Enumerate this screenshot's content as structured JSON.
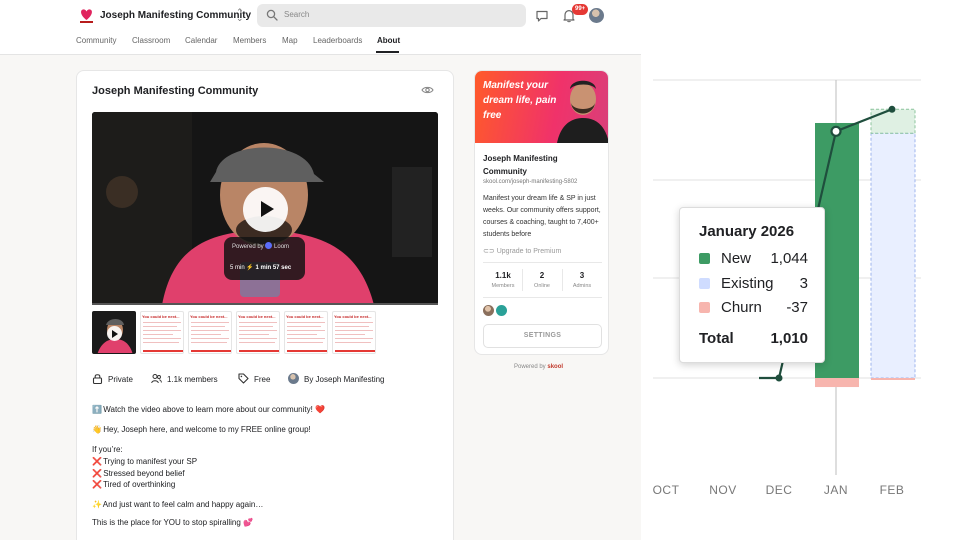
{
  "app": {
    "community_name": "Joseph Manifesting Community",
    "search_placeholder": "Search",
    "notifications_badge": "99+",
    "tabs": [
      {
        "label": "Community"
      },
      {
        "label": "Classroom"
      },
      {
        "label": "Calendar"
      },
      {
        "label": "Members"
      },
      {
        "label": "Map"
      },
      {
        "label": "Leaderboards"
      },
      {
        "label": "About"
      }
    ],
    "active_tab": "About"
  },
  "about": {
    "title": "Joseph Manifesting Community",
    "video": {
      "powered_by": "Powered by",
      "loom_label": "Loom",
      "duration_prefix": "5 min",
      "duration": "1 min 57 sec"
    },
    "thumb_caption": "You could be next...",
    "meta": {
      "privacy": "Private",
      "members": "1.1k members",
      "price": "Free",
      "owner": "By Joseph Manifesting"
    },
    "description": [
      {
        "emoji": "⬆️",
        "text": "Watch the video above to learn more about our community! ❤️"
      },
      {
        "emoji": "👋",
        "text": "Hey, Joseph here, and welcome to my FREE online group!"
      },
      {
        "emoji": "",
        "text": "If you’re:"
      },
      {
        "emoji": "❌",
        "text": "Trying to manifest your SP"
      },
      {
        "emoji": "❌",
        "text": "Stressed beyond belief"
      },
      {
        "emoji": "❌",
        "text": "Tired of overthinking"
      },
      {
        "emoji": "✨",
        "text": "And just want to feel calm and happy again…"
      },
      {
        "emoji": "",
        "text": "This is the place for YOU to stop spiralling 💕"
      }
    ]
  },
  "side_card": {
    "banner_text": "Manifest your dream life, pain free",
    "title": "Joseph Manifesting Community",
    "url": "skool.com/joseph-manifesting-5802",
    "description": "Manifest your dream life & SP in just weeks. Our community offers support, courses & coaching, taught to 7,400+ students before",
    "upgrade": "Upgrade to Premium",
    "stats": [
      {
        "value": "1.1k",
        "label": "Members"
      },
      {
        "value": "2",
        "label": "Online"
      },
      {
        "value": "3",
        "label": "Admins"
      }
    ],
    "settings_label": "SETTINGS",
    "powered_by": "Powered by",
    "powered_brand": "skool"
  },
  "chart_data": {
    "type": "bar",
    "categories": [
      "OCT",
      "NOV",
      "DEC",
      "JAN",
      "FEB"
    ],
    "series": [
      {
        "name": "New",
        "color": "#3d9b64",
        "values": [
          null,
          null,
          null,
          1044,
          null
        ]
      },
      {
        "name": "Existing",
        "color": "#cfdcff",
        "values": [
          null,
          null,
          null,
          3,
          null
        ]
      },
      {
        "name": "Churn",
        "color": "#f7b5ae",
        "values": [
          null,
          null,
          null,
          -37,
          null
        ]
      },
      {
        "name": "Total",
        "color": "#1f4e3d",
        "values": [
          null,
          null,
          0,
          1010,
          1100
        ]
      }
    ],
    "tooltip": {
      "title": "January 2026",
      "rows": [
        {
          "name": "New",
          "value": "1,044",
          "color": "#3d9b64"
        },
        {
          "name": "Existing",
          "value": "3",
          "color": "#cfdcff"
        },
        {
          "name": "Churn",
          "value": "-37",
          "color": "#f7b5ae"
        }
      ],
      "total_label": "Total",
      "total_value": "1,010"
    },
    "ylim": [
      -40,
      1220
    ],
    "grid": true
  }
}
